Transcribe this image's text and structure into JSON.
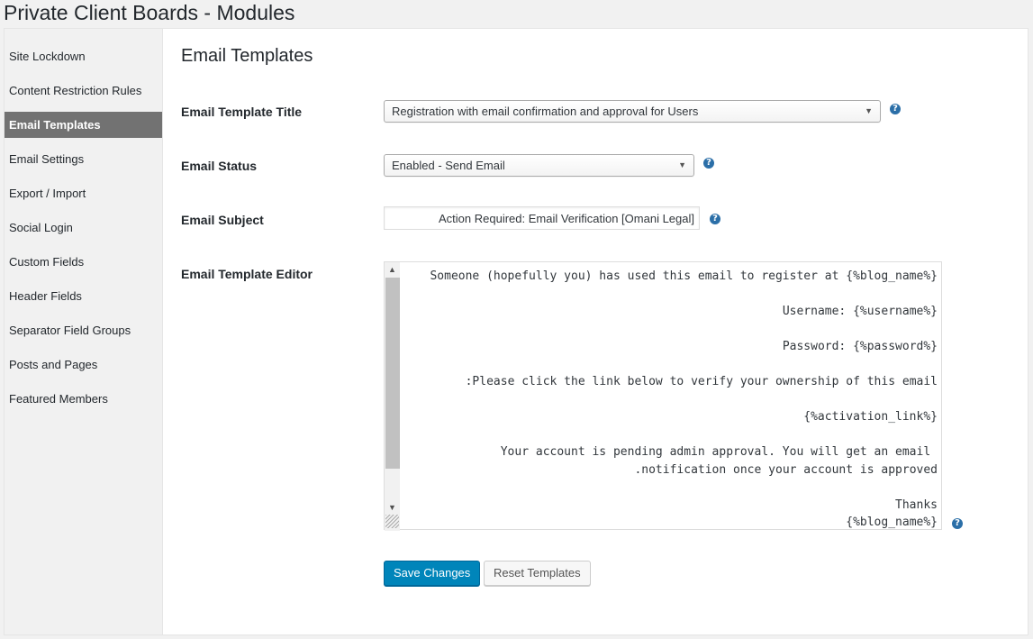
{
  "page": {
    "title": "Private Client Boards - Modules"
  },
  "sidebar": {
    "items": [
      {
        "label": "Site Lockdown"
      },
      {
        "label": "Content Restriction Rules"
      },
      {
        "label": "Email Templates",
        "active": true
      },
      {
        "label": "Email Settings"
      },
      {
        "label": "Export / Import"
      },
      {
        "label": "Social Login"
      },
      {
        "label": "Custom Fields"
      },
      {
        "label": "Header Fields"
      },
      {
        "label": "Separator Field Groups"
      },
      {
        "label": "Posts and Pages"
      },
      {
        "label": "Featured Members"
      }
    ]
  },
  "main": {
    "section_title": "Email Templates",
    "template_title": {
      "label": "Email Template Title",
      "value": "Registration with email confirmation and approval for Users"
    },
    "status": {
      "label": "Email Status",
      "value": "Enabled - Send Email"
    },
    "subject": {
      "label": "Email Subject",
      "value": "Action Required: Email Verification [Omani Legal]"
    },
    "editor": {
      "label": "Email Template Editor",
      "lines": [
        "Someone (hopefully you) has used this email to register at {%blog_name%}",
        "",
        "Username: {%username%}",
        "",
        "Password: {%password%}",
        "",
        ":Please click the link below to verify your ownership of this email",
        "",
        "{%activation_link%}",
        "",
        "Your account is pending admin approval. You will get an email ",
        ".notification once your account is approved",
        "",
        "Thanks",
        "{%blog_name%}"
      ]
    },
    "help_glyph": "?",
    "buttons": {
      "save": "Save Changes",
      "reset": "Reset Templates"
    }
  },
  "colors": {
    "primary_button": "#0085ba",
    "active_sidebar": "#727272",
    "help_icon": "#2b6fa8"
  }
}
